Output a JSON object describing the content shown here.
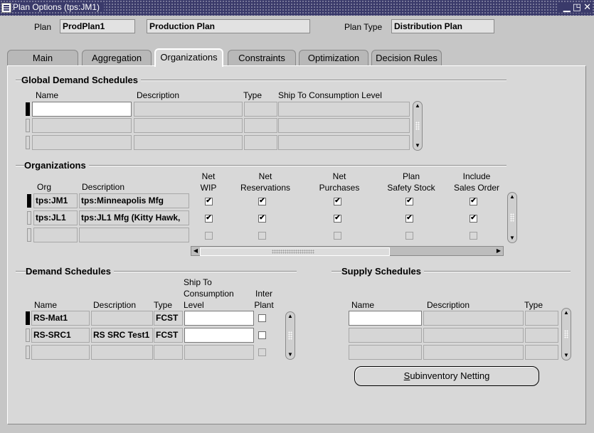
{
  "window": {
    "title": "Plan Options (tps:JM1)",
    "controls": [
      "minimize-icon",
      "maximize-icon",
      "close-icon"
    ]
  },
  "header": {
    "plan_label": "Plan",
    "plan_name": "ProdPlan1",
    "plan_description": "Production Plan",
    "plan_type_label": "Plan Type",
    "plan_type": "Distribution Plan"
  },
  "tabs": [
    {
      "label": "Main"
    },
    {
      "label": "Aggregation"
    },
    {
      "label": "Organizations",
      "active": true
    },
    {
      "label": "Constraints"
    },
    {
      "label": "Optimization"
    },
    {
      "label": "Decision Rules"
    }
  ],
  "global_demand": {
    "title": "Global Demand Schedules",
    "columns": [
      "Name",
      "Description",
      "Type",
      "Ship To Consumption Level"
    ]
  },
  "organizations": {
    "title": "Organizations",
    "col_org": "Org",
    "col_desc": "Description",
    "col_netwip": [
      "Net",
      "WIP"
    ],
    "col_netres": [
      "Net",
      "Reservations"
    ],
    "col_netpur": [
      "Net",
      "Purchases"
    ],
    "col_plansafety": [
      "Plan",
      "Safety Stock"
    ],
    "col_incsales": [
      "Include",
      "Sales Order"
    ],
    "rows": [
      {
        "org": "tps:JM1",
        "desc": "tps:Minneapolis Mfg",
        "flags": [
          true,
          true,
          true,
          true,
          true
        ]
      },
      {
        "org": "tps:JL1",
        "desc": "tps:JL1 Mfg (Kitty Hawk,",
        "flags": [
          true,
          true,
          true,
          true,
          true
        ]
      },
      {
        "org": "",
        "desc": "",
        "flags": [
          false,
          false,
          false,
          false,
          false
        ]
      }
    ]
  },
  "demand": {
    "title": "Demand Schedules",
    "col_name": "Name",
    "col_desc": "Description",
    "col_type": "Type",
    "col_ship": [
      "Ship To",
      "Consumption",
      "Level"
    ],
    "col_inter": [
      "Inter",
      "Plant"
    ],
    "rows": [
      {
        "name": "RS-Mat1",
        "desc": "",
        "type": "FCST",
        "ship": ""
      },
      {
        "name": "RS-SRC1",
        "desc": "RS SRC Test1",
        "type": "FCST",
        "ship": ""
      },
      {
        "name": "",
        "desc": "",
        "type": "",
        "ship": ""
      }
    ]
  },
  "supply": {
    "title": "Supply Schedules",
    "columns": [
      "Name",
      "Description",
      "Type"
    ]
  },
  "subinventory_button": "Subinventory Netting"
}
